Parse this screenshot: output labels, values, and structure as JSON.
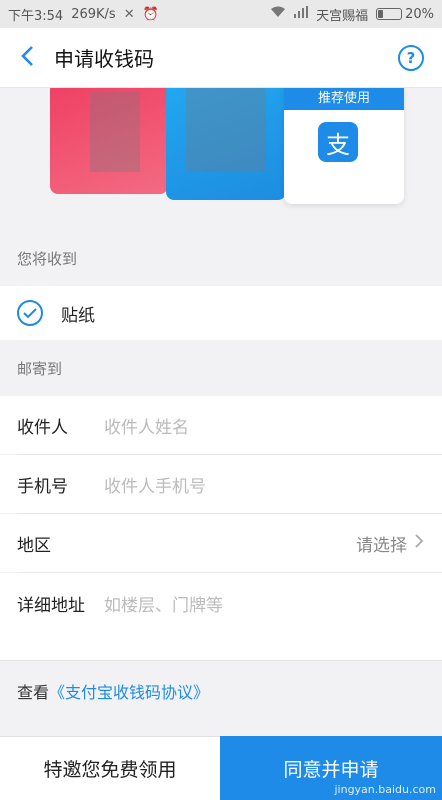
{
  "status_bar": {
    "time": "下午3:54",
    "speed": "269K/s",
    "carrier": "天宫赐福",
    "battery": "20%",
    "battery_level": 0.2
  },
  "nav": {
    "title": "申请收钱码",
    "back_icon": "chevron-left-icon",
    "help_icon": "question-circle-icon",
    "help_glyph": "?"
  },
  "banner": {
    "recommend_label": "推荐使用",
    "logo_glyph": "支"
  },
  "receive": {
    "section_label": "您将收到",
    "item_label": "贴纸",
    "checked": true
  },
  "mail": {
    "section_label": "邮寄到"
  },
  "form": {
    "recipient_label": "收件人",
    "recipient_placeholder": "收件人姓名",
    "phone_label": "手机号",
    "phone_placeholder": "收件人手机号",
    "region_label": "地区",
    "region_value": "请选择",
    "address_label": "详细地址",
    "address_placeholder": "如楼层、门牌等"
  },
  "agreement": {
    "prefix": "查看",
    "link": "《支付宝收钱码协议》"
  },
  "bottom": {
    "invite_label": "特邀您免费领用",
    "agree_label": "同意并申请",
    "watermark": "jingyan.baidu.com"
  },
  "colors": {
    "accent": "#1e8be8",
    "card_red": "#ef3f62",
    "card_blue": "#22a7f0"
  }
}
